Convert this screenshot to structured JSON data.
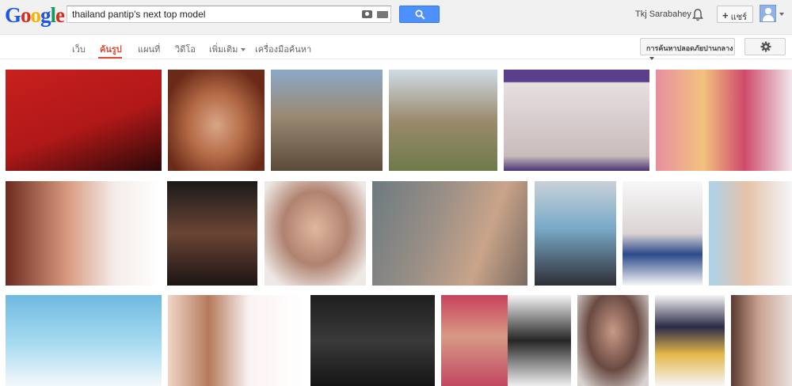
{
  "header": {
    "logo": [
      "G",
      "o",
      "o",
      "g",
      "l",
      "e"
    ],
    "logo_colors": [
      "#1a55e4",
      "#d62d20",
      "#f4b400",
      "#1a55e4",
      "#0f9d58",
      "#d62d20"
    ],
    "search_value": "thailand pantip's next top model",
    "user_name": "Tkj Sarabahey",
    "share_label": "แชร์",
    "share_plus": "+"
  },
  "nav": {
    "tabs": [
      {
        "label": "เว็บ",
        "active": false
      },
      {
        "label": "ค้นรูป",
        "active": true
      },
      {
        "label": "แผนที่",
        "active": false
      },
      {
        "label": "วิดีโอ",
        "active": false
      },
      {
        "label": "เพิ่มเติม",
        "active": false
      },
      {
        "label": "เครื่องมือค้นหา",
        "active": false
      }
    ],
    "safe_search_label": "การค้นหาปลอดภัยปานกลาง"
  },
  "colors": {
    "accent": "#dd4b39",
    "search_button": "#4d90fe"
  }
}
